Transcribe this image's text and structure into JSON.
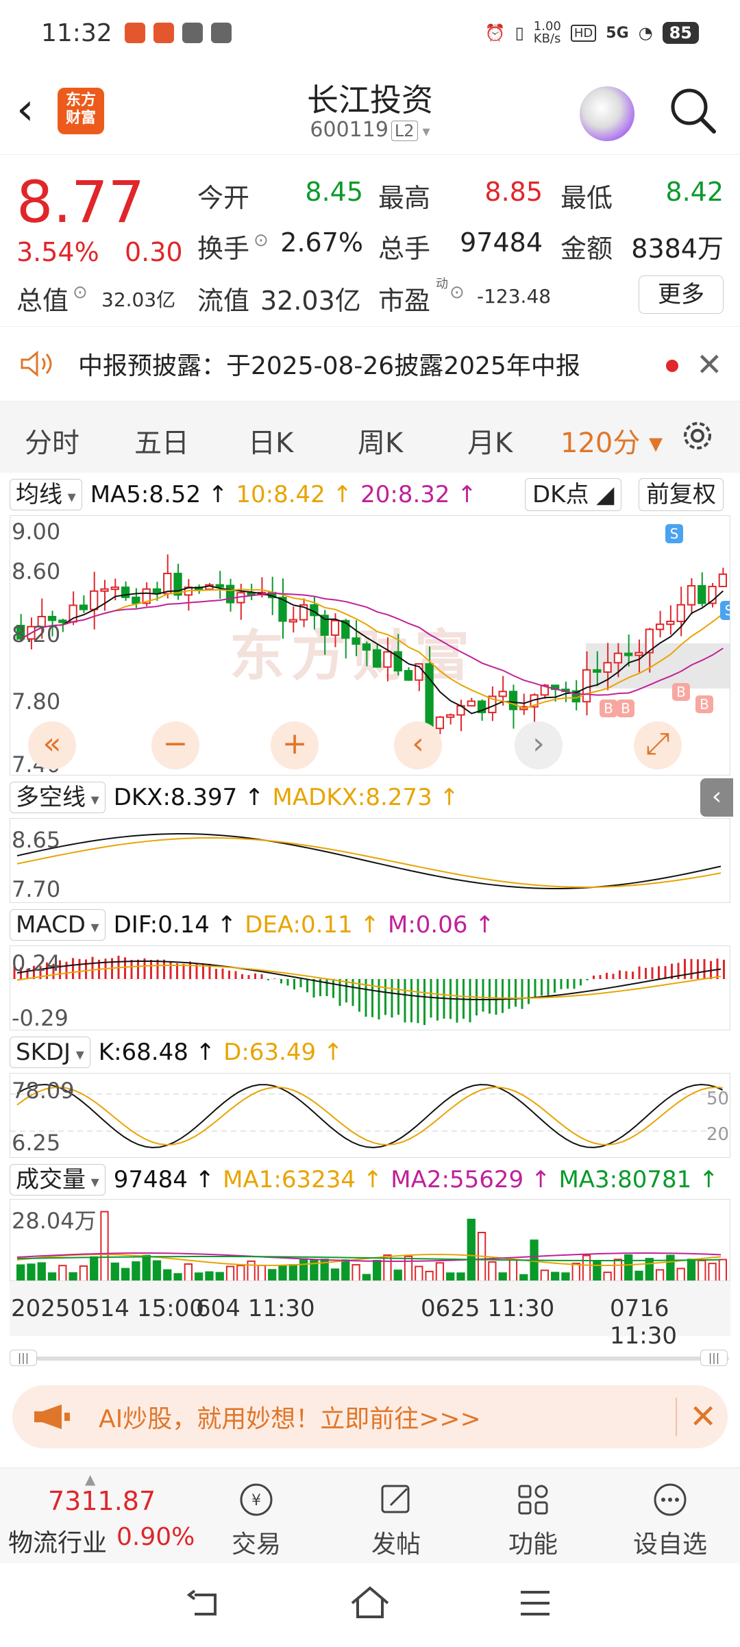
{
  "status": {
    "time": "11:32",
    "net_speed": "1.00\nKB/s",
    "network": "5G",
    "battery": "85"
  },
  "header": {
    "back_icon": "back-arrow-icon",
    "brand_logo": "东方财富",
    "title": "长江投资",
    "code": "600119",
    "level": "L2"
  },
  "quote": {
    "price": "8.77",
    "change_pct": "3.54%",
    "change": "0.30",
    "open_label": "今开",
    "open": "8.45",
    "high_label": "最高",
    "high": "8.85",
    "low_label": "最低",
    "low": "8.42",
    "turnover_label": "换手",
    "turnover": "2.67%",
    "volume_label": "总手",
    "volume": "97484",
    "amount_label": "金额",
    "amount": "8384万",
    "mktcap_label": "总值",
    "mktcap": "32.03亿",
    "float_label": "流值",
    "float": "32.03亿",
    "pe_label": "市盈",
    "pe_sup": "动",
    "pe": "-123.48",
    "more": "更多"
  },
  "notice": {
    "text": "中报预披露：于2025-08-26披露2025年中报"
  },
  "tabs": [
    {
      "label": "分时"
    },
    {
      "label": "五日"
    },
    {
      "label": "日K"
    },
    {
      "label": "周K"
    },
    {
      "label": "月K"
    },
    {
      "label": "120分 ▾"
    }
  ],
  "main_chart": {
    "indicator": "均线",
    "ma5": "MA5:8.52 ↑",
    "ma10": "10:8.42 ↑",
    "ma20": "20:8.32 ↑",
    "dk_button": "DK点",
    "adjust_button": "前复权",
    "y_labels": [
      "9.00",
      "8.60",
      "8.20",
      "7.80",
      "7.40"
    ],
    "watermark": "东方财富"
  },
  "dkx": {
    "indicator": "多空线",
    "dkx": "DKX:8.397 ↑",
    "madkx": "MADKX:8.273 ↑",
    "y_labels": [
      "8.65",
      "7.70"
    ]
  },
  "macd": {
    "indicator": "MACD",
    "dif": "DIF:0.14 ↑",
    "dea": "DEA:0.11 ↑",
    "m": "M:0.06 ↑",
    "y_labels": [
      "0.24",
      "-0.29"
    ]
  },
  "skdj": {
    "indicator": "SKDJ",
    "k": "K:68.48 ↑",
    "d": "D:63.49 ↑",
    "y_labels": [
      "78.09",
      "6.25"
    ],
    "right_labels": [
      "50",
      "20"
    ]
  },
  "vol": {
    "indicator": "成交量",
    "vol": "97484 ↑",
    "ma1": "MA1:63234 ↑",
    "ma2": "MA2:55629 ↑",
    "ma3": "MA3:80781 ↑",
    "y_label": "28.04万"
  },
  "timeline": {
    "t1": "20250514 15:00",
    "t2": "604 11:30",
    "t3": "0625 11:30",
    "t4": "0716 11:30"
  },
  "ad": {
    "text": "AI炒股，就用妙想！立即前往>>>"
  },
  "bottom": {
    "index_value": "7311.87",
    "index_name": "物流行业",
    "index_pct": "0.90%",
    "items": [
      {
        "label": "交易"
      },
      {
        "label": "发帖"
      },
      {
        "label": "功能"
      },
      {
        "label": "设自选"
      }
    ]
  },
  "colors": {
    "up": "#e0262a",
    "down": "#0a9a2a",
    "accent": "#e0762a",
    "ma_yellow": "#e8a400",
    "ma_magenta": "#c0209a"
  }
}
